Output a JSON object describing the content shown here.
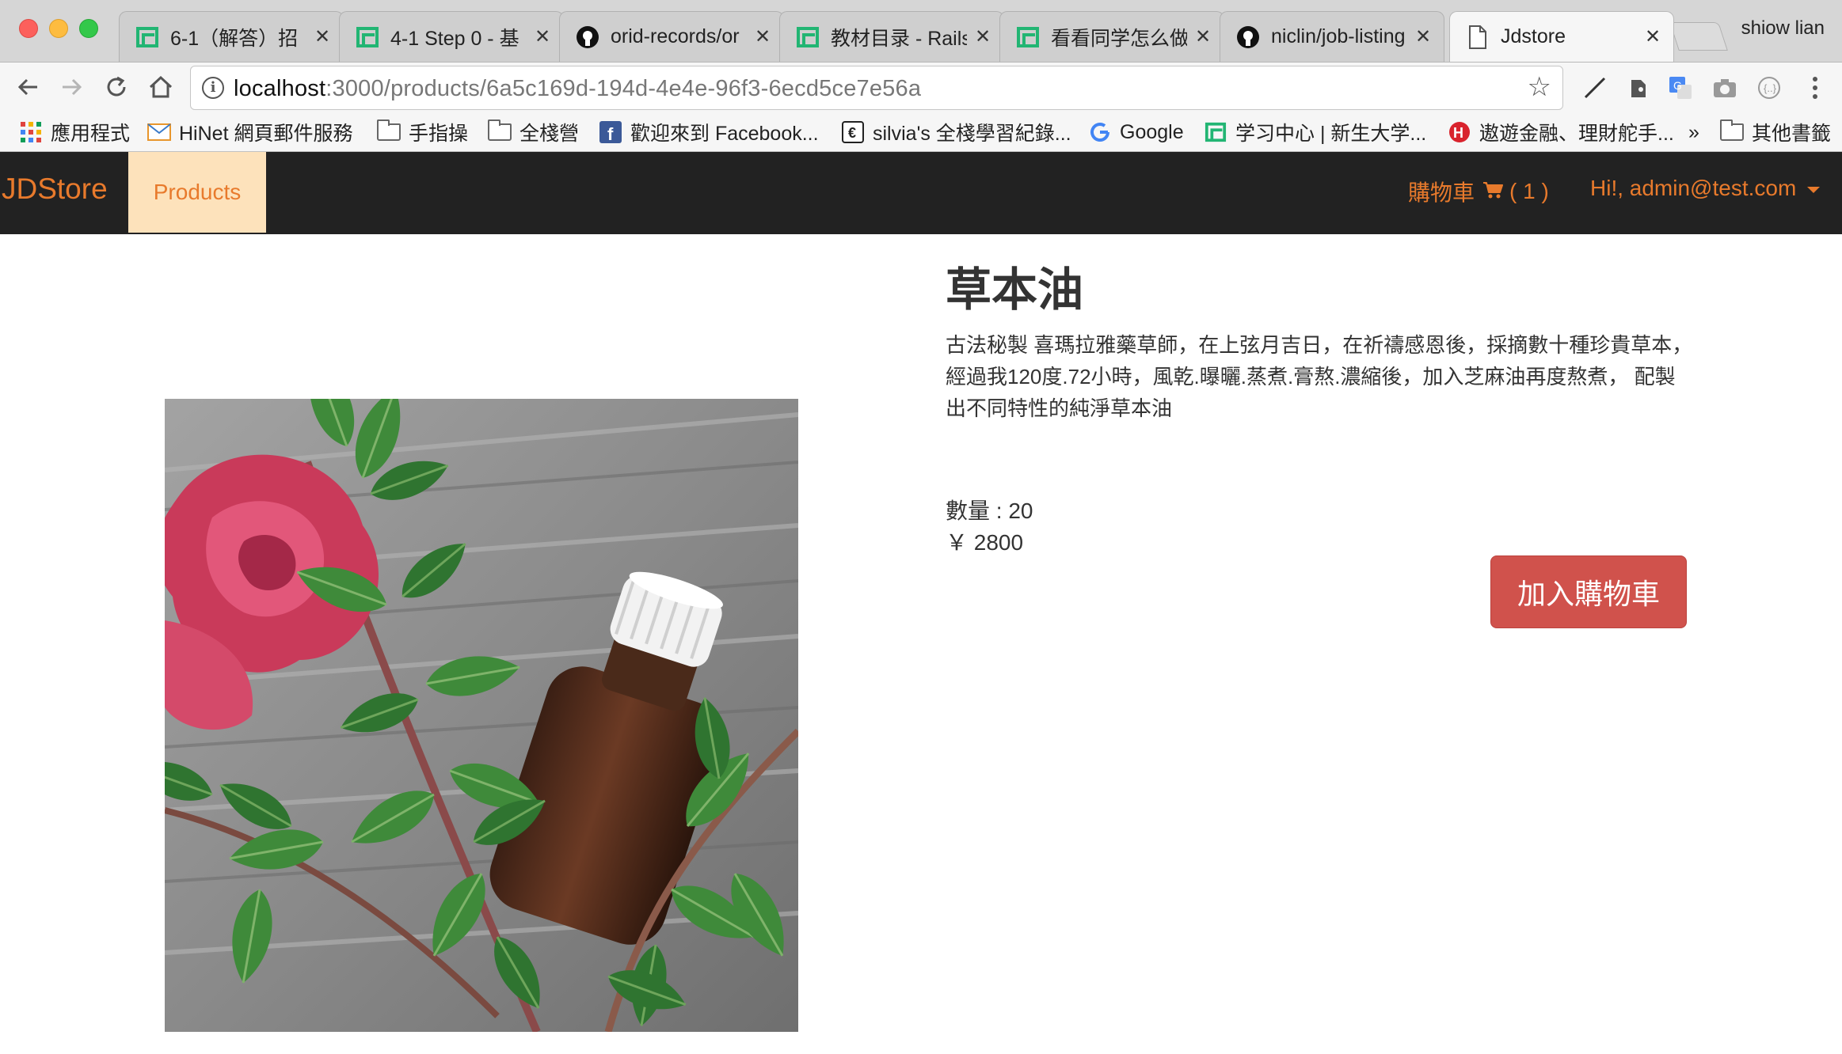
{
  "browser": {
    "tabs": [
      {
        "title": "6-1（解答）招",
        "icon": "xinsheng-icon",
        "active": false
      },
      {
        "title": "4-1 Step 0 - 基",
        "icon": "xinsheng-icon",
        "active": false
      },
      {
        "title": "orid-records/or",
        "icon": "github-icon",
        "active": false
      },
      {
        "title": "教材目录 - Rails",
        "icon": "xinsheng-icon",
        "active": false
      },
      {
        "title": "看看同学怎么做",
        "icon": "xinsheng-icon",
        "active": false
      },
      {
        "title": "niclin/job-listing",
        "icon": "github-icon",
        "active": false
      },
      {
        "title": "Jdstore",
        "icon": "page-icon",
        "active": true
      }
    ],
    "profile_name": "shiow lian",
    "url_host": "localhost",
    "url_path": ":3000/products/6a5c169d-194d-4e4e-96f3-6ecd5ce7e56a",
    "bookmarks": [
      {
        "label": "應用程式",
        "icon": "apps-grid-icon"
      },
      {
        "label": "HiNet 網頁郵件服務",
        "icon": "mail-icon"
      },
      {
        "label": "手指操",
        "icon": "folder-icon"
      },
      {
        "label": "全棧營",
        "icon": "folder-icon"
      },
      {
        "label": "歡迎來到 Facebook...",
        "icon": "facebook-icon"
      },
      {
        "label": "silvia's 全棧學習紀錄...",
        "icon": "blog-icon"
      },
      {
        "label": "Google",
        "icon": "google-icon"
      },
      {
        "label": "学习中心 | 新生大学...",
        "icon": "xinsheng-icon"
      },
      {
        "label": "遨遊金融、理財舵手...",
        "icon": "finance-icon"
      },
      {
        "label": "其他書籤",
        "icon": "folder-icon"
      }
    ],
    "bookmarks_overflow": "»"
  },
  "site": {
    "brand": "JDStore",
    "nav_products": "Products",
    "cart_label": "購物車",
    "cart_count": "( 1 )",
    "user_greeting": "Hi!, admin@test.com"
  },
  "product": {
    "title": "草本油",
    "description": "古法秘製 喜瑪拉雅藥草師，在上弦月吉日，在祈禱感恩後，採摘數十種珍貴草本， 經過我120度.72小時，風乾.曝曬.蒸煮.膏熬.濃縮後，加入芝麻油再度熬煮， 配製出不同特性的純淨草本油",
    "quantity": "數量 : 20",
    "price": "￥ 2800",
    "add_to_cart": "加入購物車",
    "image_alt_icon": "herbal-oil-photo"
  },
  "colors": {
    "brand_orange": "#e87a2c",
    "navbar_bg": "#222222",
    "active_nav_bg": "#fde2bb",
    "button_red": "#d0524c"
  }
}
